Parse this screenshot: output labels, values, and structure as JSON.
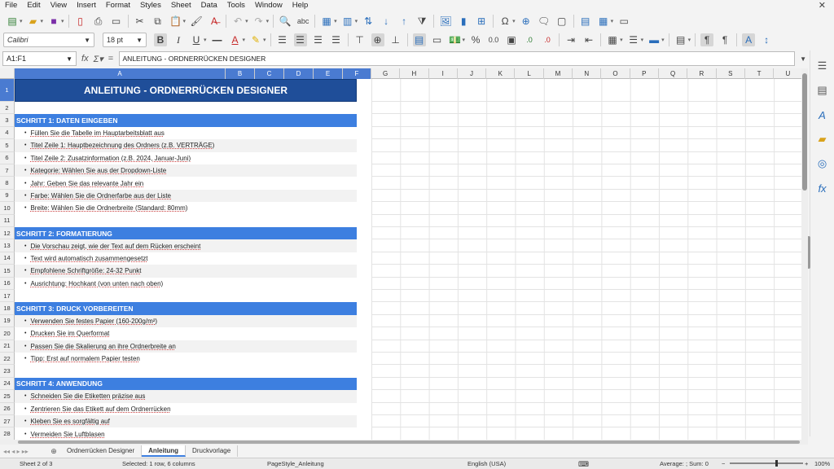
{
  "menu": [
    "File",
    "Edit",
    "View",
    "Insert",
    "Format",
    "Styles",
    "Sheet",
    "Data",
    "Tools",
    "Window",
    "Help"
  ],
  "font": {
    "name": "Calibri",
    "size": "18 pt"
  },
  "formula": {
    "cell_ref": "A1:F1",
    "content": "ANLEITUNG - ORDNERRÜCKEN DESIGNER"
  },
  "columns": [
    "A",
    "B",
    "C",
    "D",
    "E",
    "F",
    "G",
    "H",
    "I",
    "J",
    "K",
    "L",
    "M",
    "N",
    "O",
    "P",
    "Q",
    "R",
    "S",
    "T",
    "U"
  ],
  "rows": [
    {
      "n": "1",
      "type": "title",
      "text": "ANLEITUNG - ORDNERRÜCKEN DESIGNER"
    },
    {
      "n": "2",
      "type": "empty",
      "text": ""
    },
    {
      "n": "3",
      "type": "section",
      "text": "SCHRITT 1: DATEN EINGEBEN"
    },
    {
      "n": "4",
      "type": "bullet",
      "text": "Füllen Sie die Tabelle im Hauptarbeitsblatt aus"
    },
    {
      "n": "5",
      "type": "bullet",
      "text": "Titel Zeile 1: Hauptbezeichnung des Ordners (z.B. VERTRÄGE)"
    },
    {
      "n": "6",
      "type": "bullet",
      "text": "Titel Zeile 2: Zusatzinformation (z.B. 2024, Januar-Juni)"
    },
    {
      "n": "7",
      "type": "bullet",
      "text": "Kategorie: Wählen Sie aus der Dropdown-Liste"
    },
    {
      "n": "8",
      "type": "bullet",
      "text": "Jahr: Geben Sie das relevante Jahr ein"
    },
    {
      "n": "9",
      "type": "bullet",
      "text": "Farbe: Wählen Sie die Ordnerfarbe aus der Liste"
    },
    {
      "n": "10",
      "type": "bullet",
      "text": "Breite: Wählen Sie die Ordnerbreite (Standard: 80mm)"
    },
    {
      "n": "11",
      "type": "empty",
      "text": ""
    },
    {
      "n": "12",
      "type": "section",
      "text": "SCHRITT 2: FORMATIERUNG"
    },
    {
      "n": "13",
      "type": "bullet",
      "text": "Die Vorschau zeigt, wie der Text auf dem Rücken erscheint"
    },
    {
      "n": "14",
      "type": "bullet",
      "text": "Text wird automatisch zusammengesetzt"
    },
    {
      "n": "15",
      "type": "bullet",
      "text": "Empfohlene Schriftgröße: 24-32 Punkt"
    },
    {
      "n": "16",
      "type": "bullet",
      "text": "Ausrichtung: Hochkant (von unten nach oben)"
    },
    {
      "n": "17",
      "type": "empty",
      "text": ""
    },
    {
      "n": "18",
      "type": "section",
      "text": "SCHRITT 3: DRUCK VORBEREITEN"
    },
    {
      "n": "19",
      "type": "bullet",
      "text": "Verwenden Sie festes Papier (160-200g/m²)"
    },
    {
      "n": "20",
      "type": "bullet",
      "text": "Drucken Sie im Querformat"
    },
    {
      "n": "21",
      "type": "bullet",
      "text": "Passen Sie die Skalierung an ihre Ordnerbreite an"
    },
    {
      "n": "22",
      "type": "bullet",
      "text": "Tipp: Erst auf normalem Papier testen"
    },
    {
      "n": "23",
      "type": "empty",
      "text": ""
    },
    {
      "n": "24",
      "type": "section",
      "text": "SCHRITT 4: ANWENDUNG"
    },
    {
      "n": "25",
      "type": "bullet",
      "text": "Schneiden Sie die Etiketten präzise aus"
    },
    {
      "n": "26",
      "type": "bullet",
      "text": "Zentrieren Sie das Etikett auf dem Ordnerrücken"
    },
    {
      "n": "27",
      "type": "bullet",
      "text": "Kleben Sie es sorgfältig auf"
    },
    {
      "n": "28",
      "type": "bullet",
      "text": "Vermeiden Sie Luftblasen"
    }
  ],
  "tabs": [
    "Ordnerrücken Designer",
    "Anleitung",
    "Druckvorlage"
  ],
  "active_tab": "Anleitung",
  "status": {
    "sheet": "Sheet 2 of 3",
    "selection": "Selected: 1 row, 6 columns",
    "page_style": "PageStyle_Anleitung",
    "language": "English (USA)",
    "sum": "Average: ; Sum: 0",
    "zoom": "100%"
  },
  "colors": {
    "title_bg": "#1f4e99",
    "section_bg": "#3d7fe0",
    "selection": "#4a7bd1"
  }
}
